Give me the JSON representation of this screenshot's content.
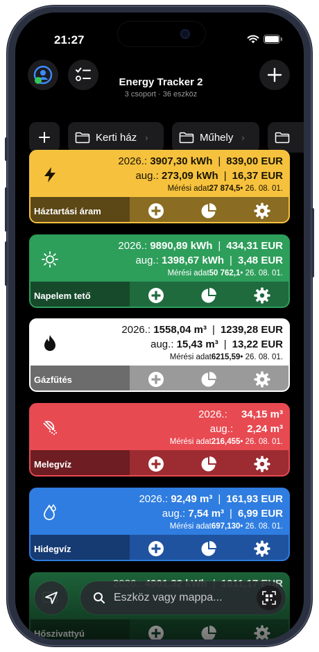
{
  "status_bar": {
    "time": "21:27"
  },
  "header": {
    "title": "Energy Tracker 2",
    "subtitle": "3 csoport · 36 eszköz"
  },
  "folders": [
    {
      "label": "Kerti ház"
    },
    {
      "label": "Műhely"
    },
    {
      "label": ""
    }
  ],
  "cards": [
    {
      "name": "Háztartási áram",
      "icon": "bolt-icon",
      "top_color": "#f6c23e",
      "bottom_color": "#8a6c22",
      "name_bg": "#5c4716",
      "text_color": "#1a1400",
      "year_label": "2026.:",
      "year_value": "3907,30 kWh",
      "year_cost": "839,00 EUR",
      "month_label": "aug.:",
      "month_value": "273,09 kWh",
      "month_cost": "16,37 EUR",
      "reading_label": "Mérési adat",
      "reading_value": "27 874,5",
      "reading_date": " • 26. 08. 01."
    },
    {
      "name": "Napelem tető",
      "icon": "sun-icon",
      "top_color": "#2e9e5b",
      "bottom_color": "#1f6b3e",
      "name_bg": "#164a2b",
      "text_color": "#ffffff",
      "year_label": "2026.:",
      "year_value": "9890,89 kWh",
      "year_cost": "434,31 EUR",
      "month_label": "aug.:",
      "month_value": "1398,67 kWh",
      "month_cost": "3,48 EUR",
      "reading_label": "Mérési adat",
      "reading_value": "50 762,1",
      "reading_date": " • 26. 08. 01."
    },
    {
      "name": "Gázfűtés",
      "icon": "flame-icon",
      "top_color": "#ffffff",
      "bottom_color": "#9a9a9a",
      "name_bg": "#6c6c6c",
      "text_color": "#111111",
      "year_label": "2026.:",
      "year_value": "1558,04 m³",
      "year_cost": "1239,28 EUR",
      "month_label": "aug.:",
      "month_value": "15,43 m³",
      "month_cost": "13,22 EUR",
      "reading_label": "Mérési adat",
      "reading_value": "6215,59",
      "reading_date": " • 26. 08. 01."
    },
    {
      "name": "Melegvíz",
      "icon": "shower-icon",
      "top_color": "#e84a52",
      "bottom_color": "#9c2c32",
      "name_bg": "#6e1d22",
      "text_color": "#ffffff",
      "year_label": "2026.:",
      "year_value": "",
      "year_cost": "34,15 m³",
      "month_label": "aug.:",
      "month_value": "",
      "month_cost": "2,24 m³",
      "reading_label": "Mérési adat",
      "reading_value": "216,455",
      "reading_date": " • 26. 08. 01."
    },
    {
      "name": "Hidegvíz",
      "icon": "droplet-icon",
      "top_color": "#2f7de0",
      "bottom_color": "#1f53a0",
      "name_bg": "#163a72",
      "text_color": "#ffffff",
      "year_label": "2026.:",
      "year_value": "92,49 m³",
      "year_cost": "161,93 EUR",
      "month_label": "aug.:",
      "month_value": "7,54 m³",
      "month_cost": "6,99 EUR",
      "reading_label": "Mérési adat",
      "reading_value": "697,130",
      "reading_date": " • 26. 08. 01."
    },
    {
      "name": "Hőszivattyú",
      "icon": "heatpump-icon",
      "top_color": "#1f6b3e",
      "bottom_color": "#174d2d",
      "name_bg": "#123a22",
      "text_color": "#ffffff",
      "year_label": "2026.:",
      "year_value": "4901,32 kWh",
      "year_cost": "1011,17 EUR",
      "month_label": "",
      "month_value": "",
      "month_cost": "",
      "reading_label": "",
      "reading_value": "",
      "reading_date": ""
    }
  ],
  "search": {
    "placeholder": "Eszköz vagy mappa..."
  }
}
